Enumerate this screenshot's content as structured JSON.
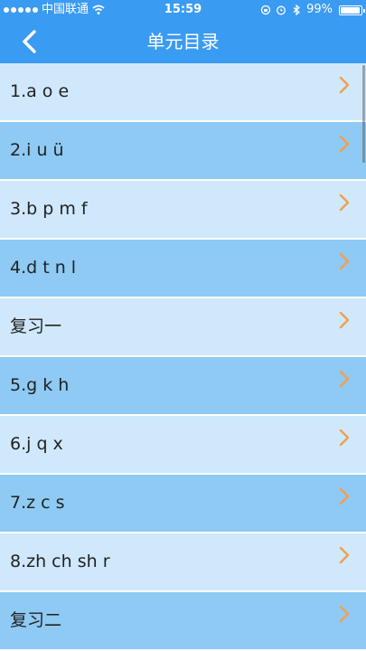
{
  "status_bar": {
    "carrier": "中国联通",
    "time": "15:59",
    "battery": "99%",
    "icons": [
      "signal-icon",
      "wifi-icon",
      "orientation-lock-icon",
      "alarm-icon",
      "bluetooth-icon",
      "battery-icon"
    ]
  },
  "nav": {
    "title": "单元目录",
    "back_icon": "back-chevron-icon"
  },
  "colors": {
    "header": "#3a9bf2",
    "row_light": "#cfe8fb",
    "row_dark": "#8ecaf3",
    "chevron": "#f0a050"
  },
  "units": [
    {
      "label": "1.a o e"
    },
    {
      "label": "2.i u ü"
    },
    {
      "label": "3.b p m f"
    },
    {
      "label": "4.d t n l"
    },
    {
      "label": "复习一"
    },
    {
      "label": "5.g k h"
    },
    {
      "label": "6.j q x"
    },
    {
      "label": "7.z c s"
    },
    {
      "label": "8.zh ch sh r"
    },
    {
      "label": "复习二"
    }
  ]
}
